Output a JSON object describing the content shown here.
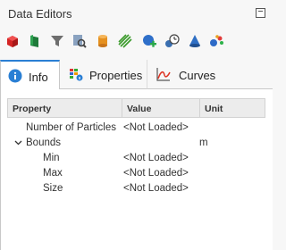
{
  "window": {
    "title": "Data Editors"
  },
  "toolbar": {
    "icons": [
      "red-cube-icon",
      "green-flag-icon",
      "funnel-icon",
      "search-doc-icon",
      "orange-cylinder-icon",
      "green-stripes-icon",
      "add-blue-circle-icon",
      "clock-sphere-icon",
      "blue-cone-icon",
      "colorful-dots-icon"
    ]
  },
  "tabs": [
    {
      "label": "Info",
      "icon": "info-icon",
      "active": true
    },
    {
      "label": "Properties",
      "icon": "properties-grid-icon",
      "active": false
    },
    {
      "label": "Curves",
      "icon": "curve-chart-icon",
      "active": false
    }
  ],
  "table": {
    "headers": {
      "property": "Property",
      "value": "Value",
      "unit": "Unit"
    },
    "rows": [
      {
        "property": "Number of Particles",
        "value": "<Not Loaded>",
        "unit": "",
        "level": 0,
        "expandable": false
      },
      {
        "property": "Bounds",
        "value": "",
        "unit": "m",
        "level": 0,
        "expandable": true,
        "expanded": true
      },
      {
        "property": "Min",
        "value": "<Not Loaded>",
        "unit": "",
        "level": 1,
        "expandable": false
      },
      {
        "property": "Max",
        "value": "<Not Loaded>",
        "unit": "",
        "level": 1,
        "expandable": false
      },
      {
        "property": "Size",
        "value": "<Not Loaded>",
        "unit": "",
        "level": 1,
        "expandable": false
      }
    ]
  },
  "colors": {
    "accent": "#2a7fd4"
  }
}
